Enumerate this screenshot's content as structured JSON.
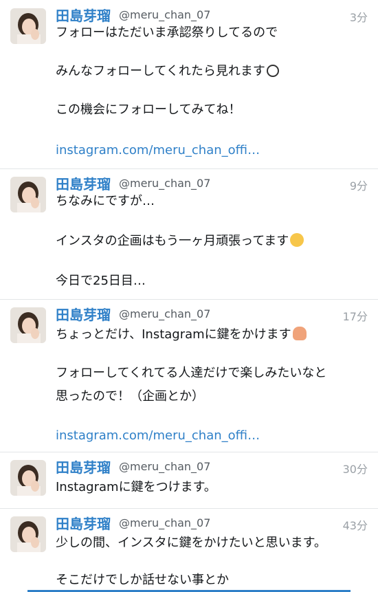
{
  "tweets": [
    {
      "name": "田島芽瑠",
      "handle": "@meru_chan_07",
      "time": "3分",
      "lines": [
        "フォローはただいま承認祭りしてるので",
        "みんなフォローしてくれたら見れます",
        "この機会にフォローしてみてね！"
      ],
      "link": "instagram.com/meru_chan_offi…"
    },
    {
      "name": "田島芽瑠",
      "handle": "@meru_chan_07",
      "time": "9分",
      "lines": [
        "ちなみにですが…",
        "インスタの企画はもう一ヶ月頑張ってます",
        "今日で25日目…"
      ]
    },
    {
      "name": "田島芽瑠",
      "handle": "@meru_chan_07",
      "time": "17分",
      "lines": [
        "ちょっとだけ、Instagramに鍵をかけます",
        "フォローしてくれてる人達だけで楽しみたいなと",
        "思ったので！（企画とか）"
      ],
      "link": "instagram.com/meru_chan_offi…"
    },
    {
      "name": "田島芽瑠",
      "handle": "@meru_chan_07",
      "time": "30分",
      "lines": [
        "Instagramに鍵をつけます。"
      ]
    },
    {
      "name": "田島芽瑠",
      "handle": "@meru_chan_07",
      "time": "43分",
      "lines": [
        "少しの間、インスタに鍵をかけたいと思います。",
        "そこだけでしか話せない事とか"
      ]
    }
  ],
  "emoji": {
    "t0_line1": "smiling-face-emoji",
    "t1_line1": "loudly-crying-face-emoji",
    "t2_line0": "person-raising-hand-emoji"
  },
  "colors": {
    "name": "#2f80c8",
    "link": "#2f80c8",
    "handle": "#555b61",
    "time": "#9aa0a6",
    "divider": "#e3e6e8"
  }
}
